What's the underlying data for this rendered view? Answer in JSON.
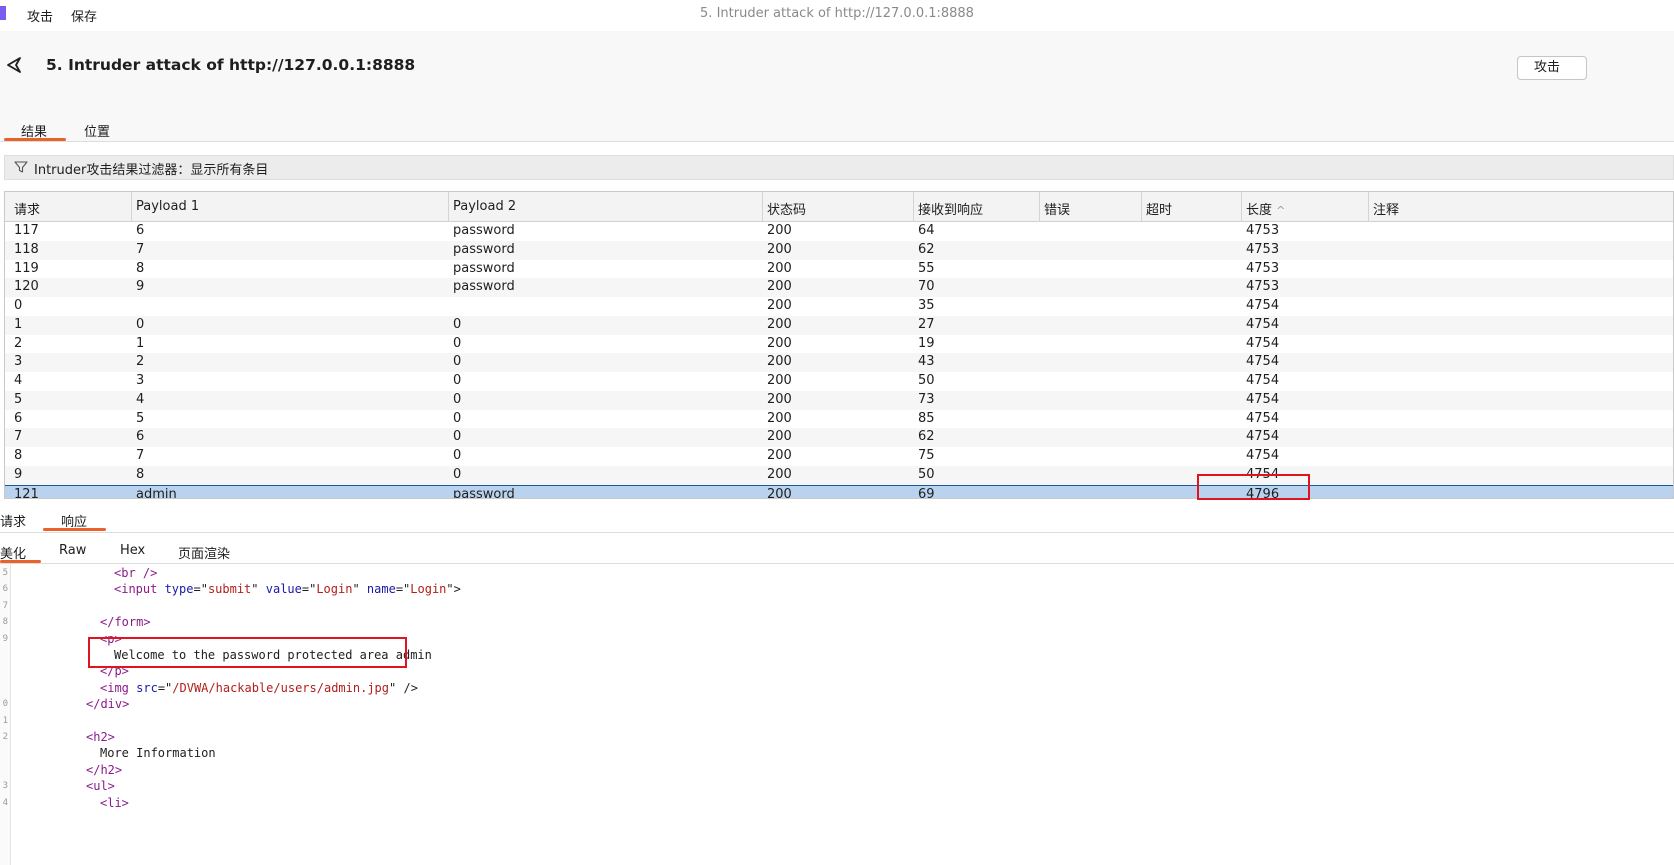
{
  "titlebar": {
    "menu": [
      "攻击",
      "保存"
    ],
    "window_title": "5. Intruder attack of http://127.0.0.1:8888"
  },
  "header": {
    "title": "5. Intruder attack of http://127.0.0.1:8888",
    "attack_button": "攻击",
    "tabs": [
      "结果",
      "位置"
    ],
    "active_tab": "结果"
  },
  "filter": {
    "text": "Intruder攻击结果过滤器：显示所有条目"
  },
  "table": {
    "columns": [
      "请求",
      "Payload 1",
      "Payload 2",
      "状态码",
      "接收到响应",
      "错误",
      "超时",
      "长度",
      "注释"
    ],
    "sort_indicator": "^",
    "rows": [
      [
        "117",
        "6",
        "password",
        "200",
        "64",
        "",
        "",
        "4753",
        ""
      ],
      [
        "118",
        "7",
        "password",
        "200",
        "62",
        "",
        "",
        "4753",
        ""
      ],
      [
        "119",
        "8",
        "password",
        "200",
        "55",
        "",
        "",
        "4753",
        ""
      ],
      [
        "120",
        "9",
        "password",
        "200",
        "70",
        "",
        "",
        "4753",
        ""
      ],
      [
        "0",
        "",
        "",
        "200",
        "35",
        "",
        "",
        "4754",
        ""
      ],
      [
        "1",
        "0",
        "0",
        "200",
        "27",
        "",
        "",
        "4754",
        ""
      ],
      [
        "2",
        "1",
        "0",
        "200",
        "19",
        "",
        "",
        "4754",
        ""
      ],
      [
        "3",
        "2",
        "0",
        "200",
        "43",
        "",
        "",
        "4754",
        ""
      ],
      [
        "4",
        "3",
        "0",
        "200",
        "50",
        "",
        "",
        "4754",
        ""
      ],
      [
        "5",
        "4",
        "0",
        "200",
        "73",
        "",
        "",
        "4754",
        ""
      ],
      [
        "6",
        "5",
        "0",
        "200",
        "85",
        "",
        "",
        "4754",
        ""
      ],
      [
        "7",
        "6",
        "0",
        "200",
        "62",
        "",
        "",
        "4754",
        ""
      ],
      [
        "8",
        "7",
        "0",
        "200",
        "75",
        "",
        "",
        "4754",
        ""
      ],
      [
        "9",
        "8",
        "0",
        "200",
        "50",
        "",
        "",
        "4754",
        ""
      ],
      [
        "121",
        "admin",
        "password",
        "200",
        "69",
        "",
        "",
        "4796",
        ""
      ]
    ],
    "selected_row": 14
  },
  "message_tabs": [
    "请求",
    "响应"
  ],
  "active_message_tab": "响应",
  "view_tabs": [
    "美化",
    "Raw",
    "Hex",
    "页面渲染"
  ],
  "active_view_tab": "美化",
  "code": {
    "lines": [
      {
        "n": "5",
        "parts": [
          [
            "tag",
            "<br />"
          ]
        ]
      },
      {
        "n": "6",
        "parts": [
          [
            "tag",
            "<input "
          ],
          [
            "attr",
            "type"
          ],
          [
            "txt",
            "=\""
          ],
          [
            "str",
            "submit"
          ],
          [
            "txt",
            "\" "
          ],
          [
            "attr",
            "value"
          ],
          [
            "txt",
            "=\""
          ],
          [
            "str",
            "Login"
          ],
          [
            "txt",
            "\" "
          ],
          [
            "attr",
            "name"
          ],
          [
            "txt",
            "=\""
          ],
          [
            "str",
            "Login"
          ],
          [
            "txt",
            "\">"
          ]
        ]
      },
      {
        "n": "7",
        "parts": []
      },
      {
        "n": "8",
        "parts": [
          [
            "tag",
            "</form>"
          ]
        ]
      },
      {
        "n": "9",
        "parts": [
          [
            "tag",
            "<p>"
          ]
        ]
      },
      {
        "n": "",
        "parts": [
          [
            "txt",
            "Welcome to the password protected area admin"
          ]
        ]
      },
      {
        "n": "",
        "parts": [
          [
            "tag",
            "</p>"
          ]
        ]
      },
      {
        "n": "",
        "parts": [
          [
            "tag",
            "<img "
          ],
          [
            "attr",
            "src"
          ],
          [
            "txt",
            "=\""
          ],
          [
            "str",
            "/DVWA/hackable/users/admin.jpg"
          ],
          [
            "txt",
            "\" />"
          ]
        ]
      },
      {
        "n": "0",
        "parts": [
          [
            "tag",
            "</div>"
          ]
        ]
      },
      {
        "n": "1",
        "parts": []
      },
      {
        "n": "2",
        "parts": [
          [
            "tag",
            "<h2>"
          ]
        ]
      },
      {
        "n": "",
        "parts": [
          [
            "txt",
            "More Information"
          ]
        ]
      },
      {
        "n": "",
        "parts": [
          [
            "tag",
            "</h2>"
          ]
        ]
      },
      {
        "n": "3",
        "parts": [
          [
            "tag",
            "<ul>"
          ]
        ]
      },
      {
        "n": "4",
        "parts": [
          [
            "tag",
            "<li>"
          ]
        ]
      }
    ]
  },
  "colors": {
    "accent": "#e8622c",
    "selected_row": "#b9d3ef",
    "highlight_box": "#e0141e"
  }
}
